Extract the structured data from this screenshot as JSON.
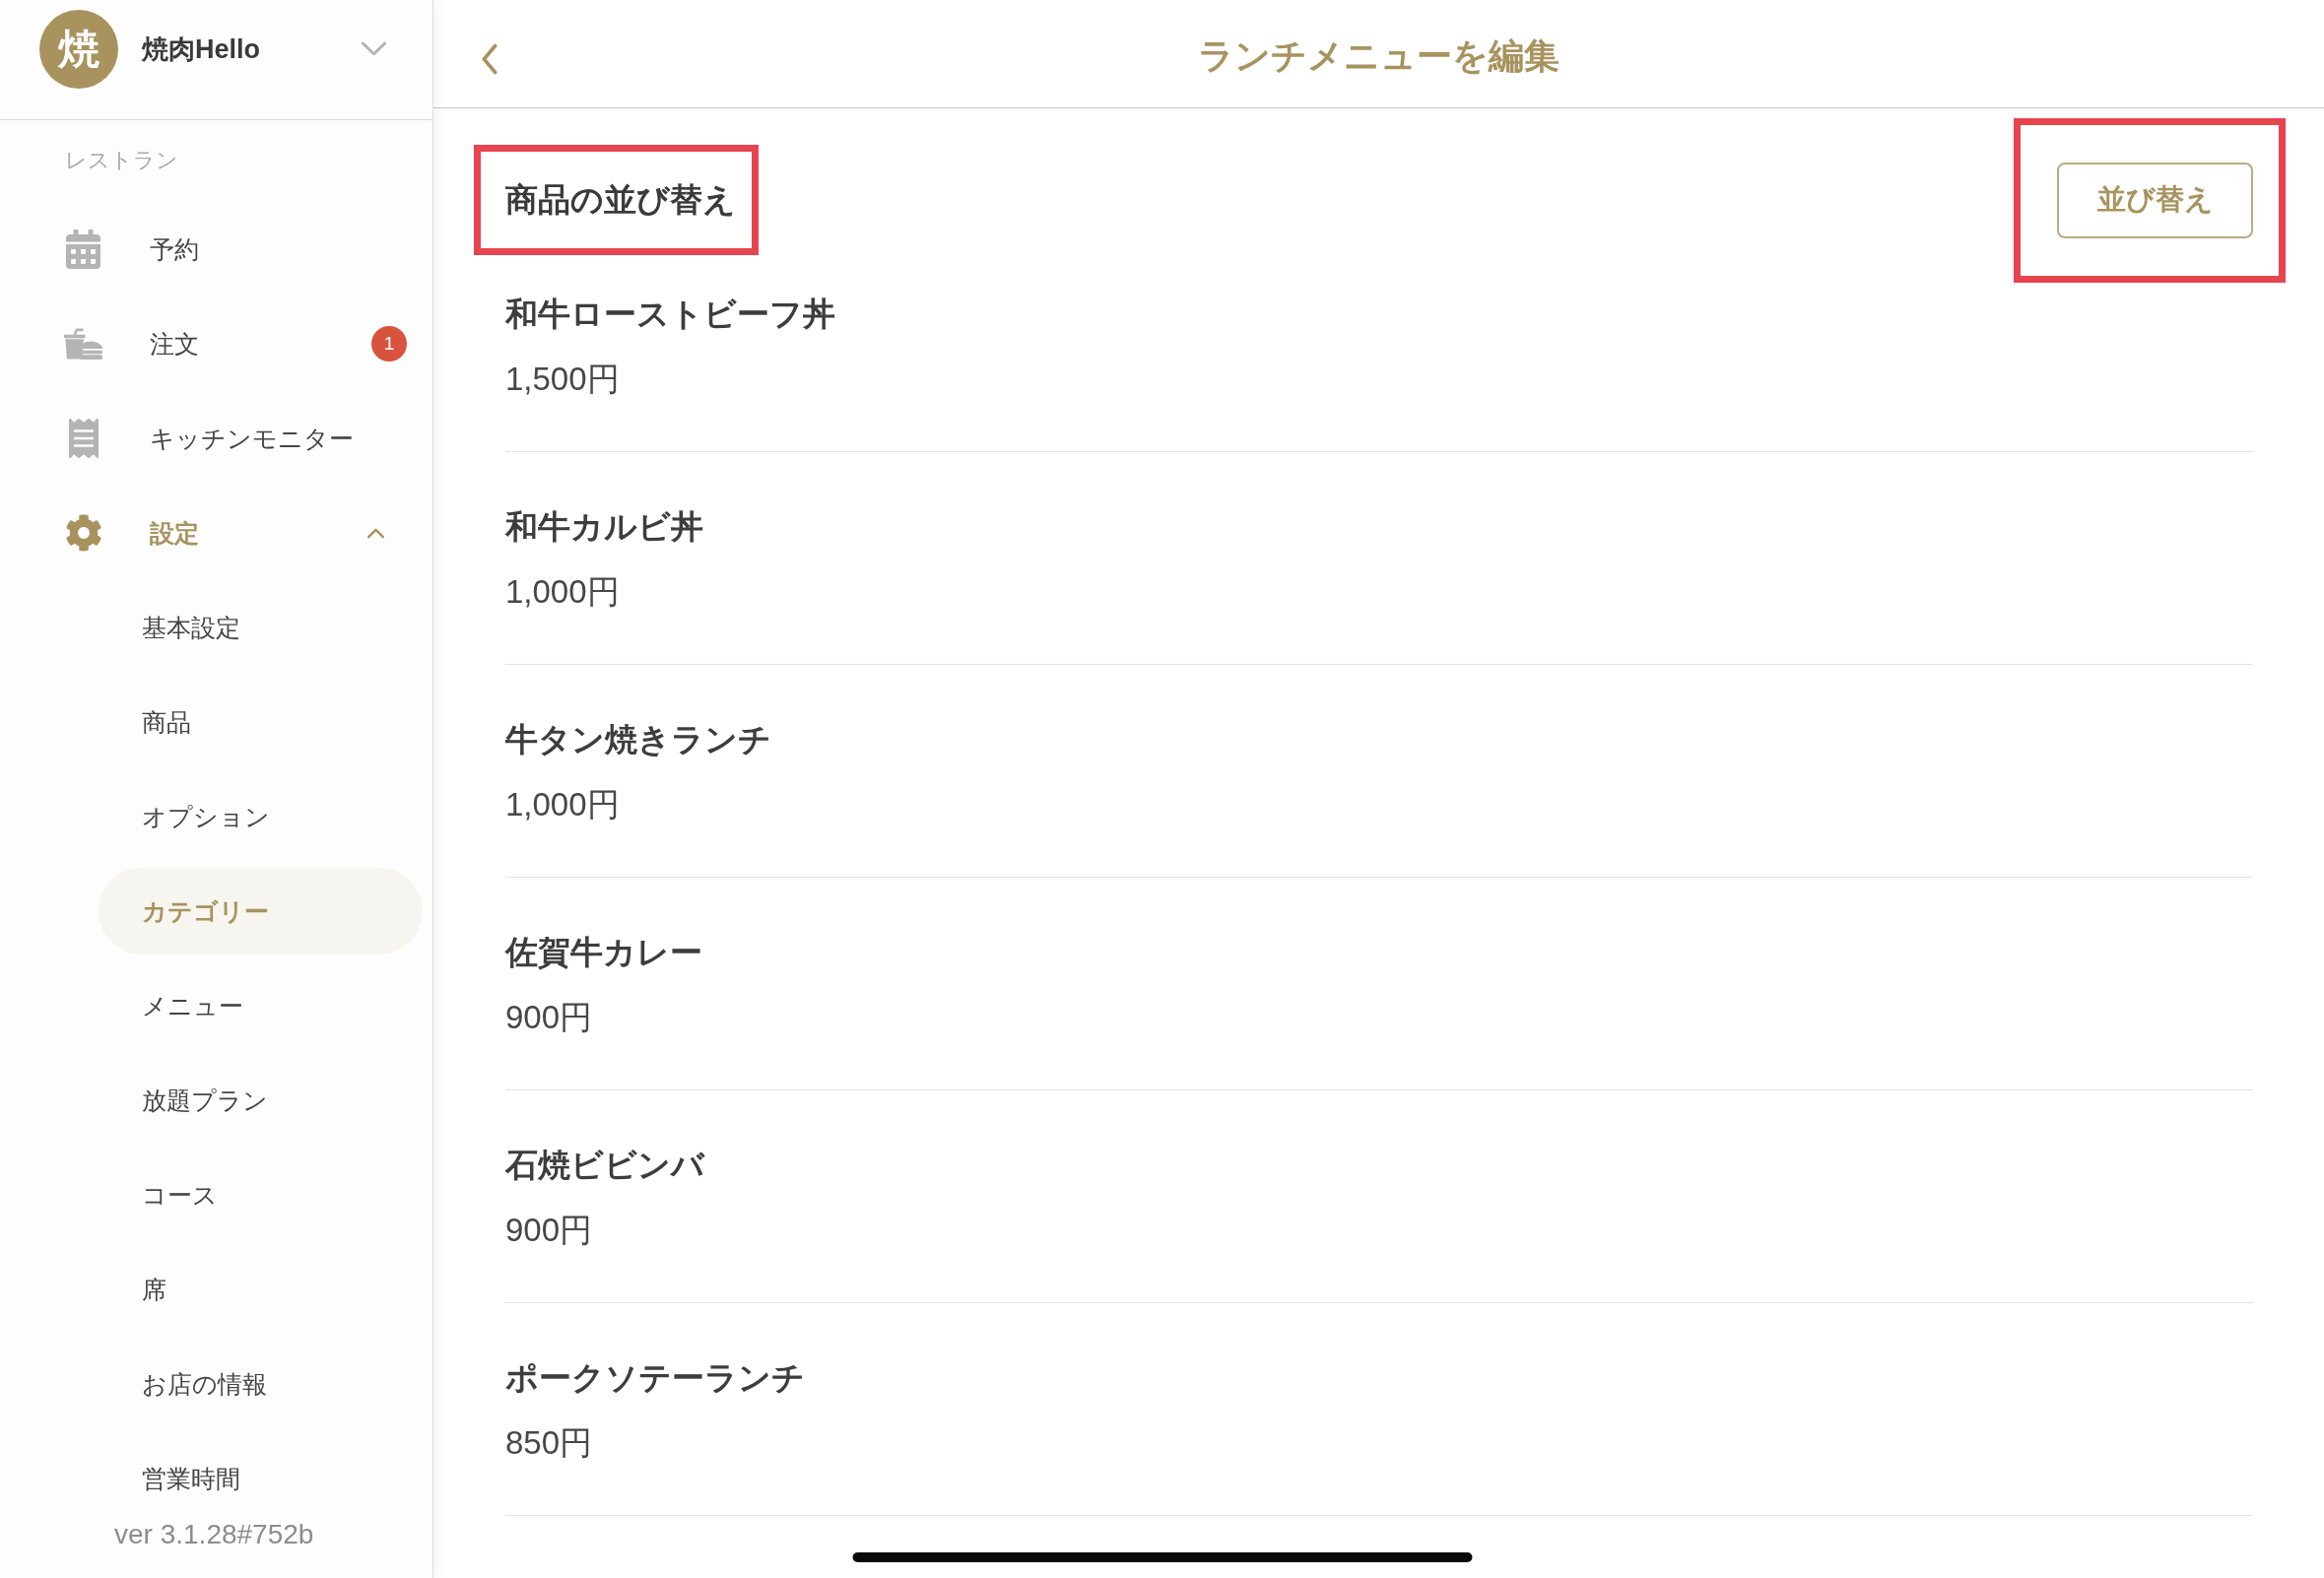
{
  "sidebar": {
    "store": {
      "avatar": "焼",
      "name": "焼肉Hello",
      "expanded": false
    },
    "section_label": "レストラン",
    "items": [
      {
        "label": "予約",
        "kind": "calendar",
        "selected": false
      },
      {
        "label": "注文",
        "kind": "orders",
        "selected": false,
        "badge": "1"
      },
      {
        "label": "キッチンモニター",
        "kind": "kitchen",
        "selected": false
      },
      {
        "label": "設定",
        "kind": "settings",
        "selected": true,
        "expanded": true,
        "children": [
          {
            "label": "基本設定",
            "selected": false
          },
          {
            "label": "商品",
            "selected": false
          },
          {
            "label": "オプション",
            "selected": false
          },
          {
            "label": "カテゴリー",
            "selected": true
          },
          {
            "label": "メニュー",
            "selected": false
          },
          {
            "label": "放題プラン",
            "selected": false
          },
          {
            "label": "コース",
            "selected": false
          },
          {
            "label": "席",
            "selected": false
          },
          {
            "label": "お店の情報",
            "selected": false
          },
          {
            "label": "営業時間",
            "selected": false
          }
        ]
      }
    ],
    "version": "ver 3.1.28#752b"
  },
  "header": {
    "title": "ランチメニューを編集"
  },
  "section": {
    "title": "商品の並び替え",
    "highlighted": true
  },
  "sort_button": {
    "label": "並び替え",
    "highlighted": true
  },
  "products": [
    {
      "name": "和牛ローストビーフ丼",
      "price": "1,500円"
    },
    {
      "name": "和牛カルビ丼",
      "price": "1,000円"
    },
    {
      "name": "牛タン焼きランチ",
      "price": "1,000円"
    },
    {
      "name": "佐賀牛カレー",
      "price": "900円"
    },
    {
      "name": "石焼ビビンバ",
      "price": "900円"
    },
    {
      "name": "ポークソテーランチ",
      "price": "850円"
    }
  ]
}
